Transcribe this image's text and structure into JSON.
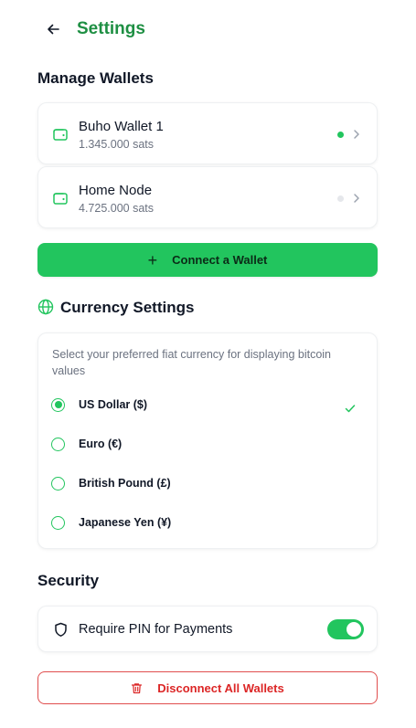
{
  "header": {
    "title": "Settings",
    "back_icon": "arrow-left-icon"
  },
  "manage_wallets": {
    "title": "Manage Wallets",
    "wallets": [
      {
        "name": "Buho Wallet 1",
        "balance": "1.345.000 sats",
        "status_color": "#22c55e",
        "active": true
      },
      {
        "name": "Home Node",
        "balance": "4.725.000 sats",
        "status_color": "#e5e7eb",
        "active": false
      }
    ],
    "connect_label": "Connect a Wallet"
  },
  "currency": {
    "title": "Currency Settings",
    "description": "Select your preferred fiat currency for displaying bitcoin values",
    "options": [
      {
        "label": "US Dollar ($)",
        "selected": true
      },
      {
        "label": "Euro (€)",
        "selected": false
      },
      {
        "label": "British Pound (£)",
        "selected": false
      },
      {
        "label": "Japanese Yen (¥)",
        "selected": false
      }
    ]
  },
  "security": {
    "title": "Security",
    "require_pin_label": "Require PIN for Payments",
    "require_pin_enabled": true
  },
  "disconnect_label": "Disconnect All Wallets",
  "colors": {
    "accent": "#22c55e",
    "title_green": "#1e8f43",
    "danger": "#dc2626"
  }
}
